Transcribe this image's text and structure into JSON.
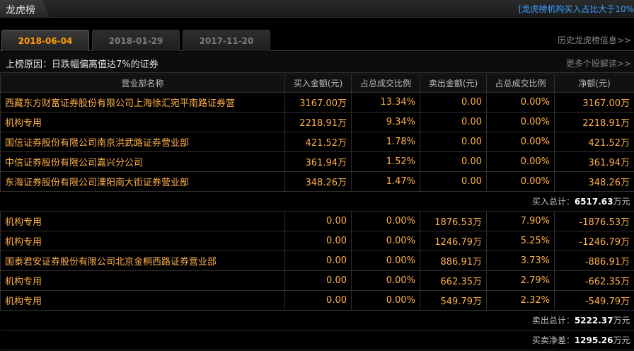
{
  "header": {
    "title": "龙虎榜",
    "top_link": "[龙虎榜机构买入占比大于10%"
  },
  "tabs": [
    {
      "label": "2018-06-04",
      "active": true
    },
    {
      "label": "2018-01-29",
      "active": false
    },
    {
      "label": "2017-11-20",
      "active": false
    }
  ],
  "history_link": "历史龙虎榜信息>>",
  "reason": "上榜原因：日跌幅偏离值达7%的证券",
  "more_link": "更多个股解读>>",
  "columns": [
    "营业部名称",
    "买入金额(元)",
    "占总成交比例",
    "卖出金额(元)",
    "占总成交比例",
    "净额(元)"
  ],
  "buy_rows": [
    [
      "西藏东方财富证券股份有限公司上海徐汇宛平南路证券营",
      "3167.00万",
      "13.34%",
      "0.00",
      "0.00%",
      "3167.00万"
    ],
    [
      "机构专用",
      "2218.91万",
      "9.34%",
      "0.00",
      "0.00%",
      "2218.91万"
    ],
    [
      "国信证券股份有限公司南京洪武路证券营业部",
      "421.52万",
      "1.78%",
      "0.00",
      "0.00%",
      "421.52万"
    ],
    [
      "中信证券股份有限公司嘉兴分公司",
      "361.94万",
      "1.52%",
      "0.00",
      "0.00%",
      "361.94万"
    ],
    [
      "东海证券股份有限公司溧阳南大街证券营业部",
      "348.26万",
      "1.47%",
      "0.00",
      "0.00%",
      "348.26万"
    ]
  ],
  "buy_total": {
    "label": "买入总计：",
    "value": "6517.63",
    "unit": "万元"
  },
  "sell_rows": [
    [
      "机构专用",
      "0.00",
      "0.00%",
      "1876.53万",
      "7.90%",
      "-1876.53万"
    ],
    [
      "机构专用",
      "0.00",
      "0.00%",
      "1246.79万",
      "5.25%",
      "-1246.79万"
    ],
    [
      "国泰君安证券股份有限公司北京金桐西路证券营业部",
      "0.00",
      "0.00%",
      "886.91万",
      "3.73%",
      "-886.91万"
    ],
    [
      "机构专用",
      "0.00",
      "0.00%",
      "662.35万",
      "2.79%",
      "-662.35万"
    ],
    [
      "机构专用",
      "0.00",
      "0.00%",
      "549.79万",
      "2.32%",
      "-549.79万"
    ]
  ],
  "sell_total": {
    "label": "卖出总计：",
    "value": "5222.37",
    "unit": "万元"
  },
  "net_total": {
    "label": "买卖净差：",
    "value": "1295.26",
    "unit": "万元"
  }
}
